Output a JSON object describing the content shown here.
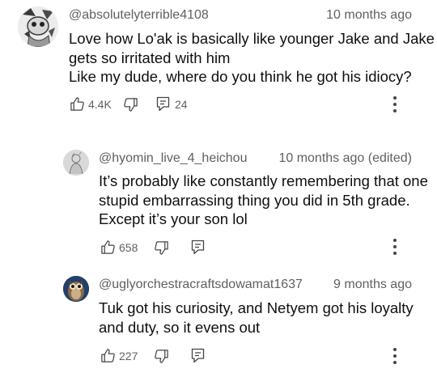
{
  "comments": [
    {
      "handle": "@absolutelyterrible4108",
      "time": "10 months ago",
      "text": [
        "Love how Lo'ak is basically like younger Jake and Jake",
        "gets so irritated with him",
        "Like my dude, where do you think he got his idiocy?"
      ],
      "likes": "4.4K",
      "replies": "24",
      "avatar_icon": "cartoon-character-avatar"
    },
    {
      "handle": "@hyomin_live_4_heichou",
      "time": "10 months ago (edited)",
      "text": [
        "It’s probably like constantly remembering that one",
        "stupid embarrassing thing you did in 5th grade.",
        "Except it’s your son lol"
      ],
      "likes": "658",
      "avatar_icon": "sketch-figure-avatar"
    },
    {
      "handle": "@uglyorchestracraftsdowamat1637",
      "time": "9 months ago",
      "text": [
        "Tuk got his curiosity, and Netyem got his loyalty",
        "and duty, so it evens out"
      ],
      "likes": "227",
      "avatar_icon": "owl-avatar"
    }
  ],
  "icons": {
    "like": "thumbs-up-icon",
    "dislike": "thumbs-down-icon",
    "reply": "reply-icon",
    "more": "more-vertical-icon"
  }
}
